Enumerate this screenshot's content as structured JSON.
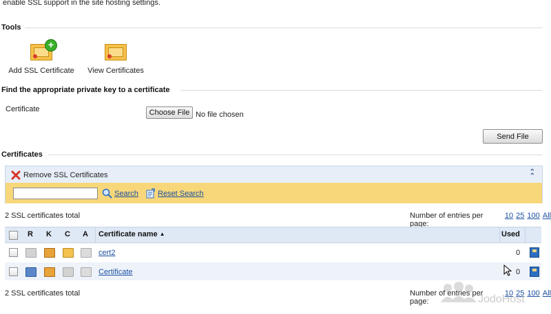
{
  "intro_text": "enable SSL support in the site hosting settings.",
  "tools": {
    "title": "Tools",
    "add_label": "Add SSL Certificate",
    "view_label": "View Certificates"
  },
  "find_key": {
    "title": "Find the appropriate private key to a certificate",
    "field_label": "Certificate",
    "choose_file": "Choose File",
    "no_file": "No file chosen",
    "send_file": "Send File"
  },
  "certificates": {
    "title": "Certificates",
    "remove_label": "Remove SSL Certificates",
    "search_label": "Search",
    "reset_label": "Reset Search",
    "search_value": "",
    "total_text": "2 SSL certificates total",
    "entries_label": "Number of entries per page:",
    "page_sizes": [
      "10",
      "25",
      "100",
      "All"
    ],
    "columns": {
      "r": "R",
      "k": "K",
      "c": "C",
      "a": "A",
      "name": "Certificate name",
      "used": "Used"
    },
    "rows": [
      {
        "name": "cert2",
        "used": "0"
      },
      {
        "name": "Certificate",
        "used": "0"
      }
    ]
  },
  "watermark": "JodoHost",
  "colors": {
    "link": "#1a4fa0",
    "search_bar": "#f7d77a",
    "panel_header": "#e7eef8",
    "remove_icon": "#d8342a",
    "plus_icon": "#3aae2a"
  }
}
